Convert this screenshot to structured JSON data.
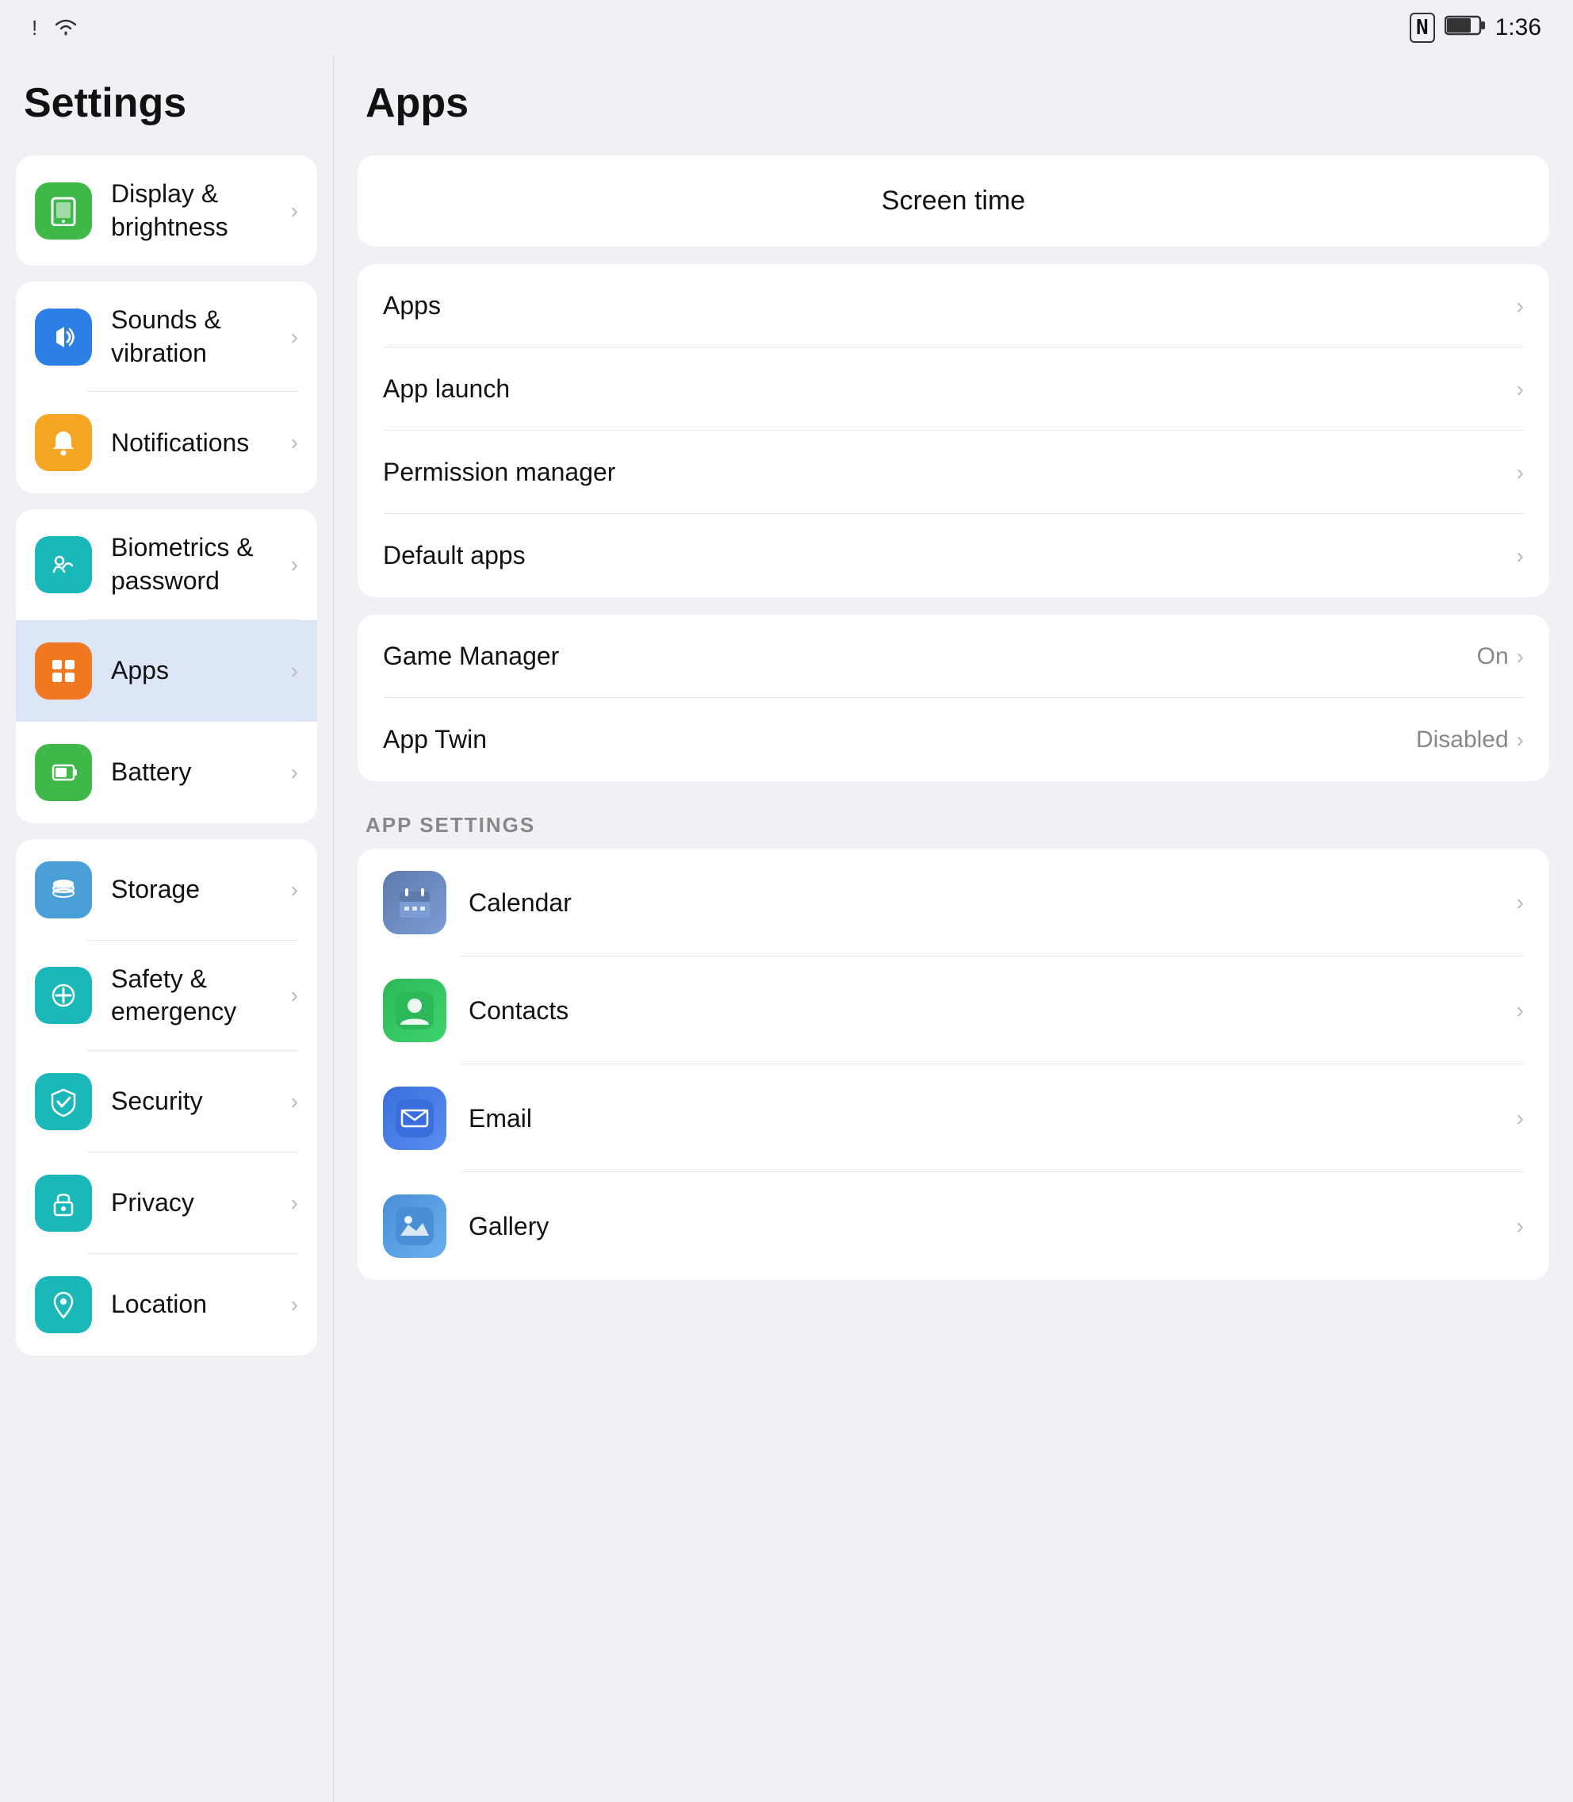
{
  "statusBar": {
    "time": "1:36",
    "battery": "🔋",
    "wifi": "📶",
    "nfc": "N",
    "alert": "!"
  },
  "leftPanel": {
    "title": "Settings",
    "cards": [
      {
        "id": "card1",
        "items": [
          {
            "id": "display",
            "iconClass": "icon-green",
            "iconSymbol": "📱",
            "label": "Display & brightness",
            "active": false
          }
        ]
      },
      {
        "id": "card2",
        "items": [
          {
            "id": "sounds",
            "iconClass": "icon-blue",
            "iconSymbol": "🔊",
            "label": "Sounds & vibration",
            "active": false
          },
          {
            "id": "notifications",
            "iconClass": "icon-orange",
            "iconSymbol": "🔔",
            "label": "Notifications",
            "active": false
          }
        ]
      },
      {
        "id": "card3",
        "items": [
          {
            "id": "biometrics",
            "iconClass": "icon-teal",
            "iconSymbol": "🔑",
            "label": "Biometrics & password",
            "active": false
          },
          {
            "id": "apps",
            "iconClass": "icon-orange2",
            "iconSymbol": "⊞",
            "label": "Apps",
            "active": true
          },
          {
            "id": "battery",
            "iconClass": "icon-green2",
            "iconSymbol": "🔋",
            "label": "Battery",
            "active": false
          }
        ]
      },
      {
        "id": "card4",
        "items": [
          {
            "id": "storage",
            "iconClass": "icon-blue2",
            "iconSymbol": "🗄",
            "label": "Storage",
            "active": false
          },
          {
            "id": "safety",
            "iconClass": "icon-teal2",
            "iconSymbol": "✱",
            "label": "Safety & emergency",
            "active": false
          },
          {
            "id": "security",
            "iconClass": "icon-teal3",
            "iconSymbol": "✔",
            "label": "Security",
            "active": false
          },
          {
            "id": "privacy",
            "iconClass": "icon-teal4",
            "iconSymbol": "🔒",
            "label": "Privacy",
            "active": false
          },
          {
            "id": "location",
            "iconClass": "icon-teal5",
            "iconSymbol": "📍",
            "label": "Location",
            "active": false
          }
        ]
      }
    ]
  },
  "rightPanel": {
    "title": "Apps",
    "screenTimeLabel": "Screen time",
    "mainItems": [
      {
        "id": "apps-item",
        "label": "Apps",
        "value": ""
      },
      {
        "id": "app-launch",
        "label": "App launch",
        "value": ""
      },
      {
        "id": "permission-manager",
        "label": "Permission manager",
        "value": ""
      },
      {
        "id": "default-apps",
        "label": "Default apps",
        "value": ""
      }
    ],
    "extraItems": [
      {
        "id": "game-manager",
        "label": "Game Manager",
        "value": "On"
      },
      {
        "id": "app-twin",
        "label": "App Twin",
        "value": "Disabled"
      }
    ],
    "appSettingsHeader": "APP SETTINGS",
    "appSettings": [
      {
        "id": "calendar",
        "label": "Calendar",
        "iconClass": "app-icon-calendar",
        "iconSymbol": "📅"
      },
      {
        "id": "contacts",
        "label": "Contacts",
        "iconClass": "app-icon-contacts",
        "iconSymbol": "👤"
      },
      {
        "id": "email",
        "label": "Email",
        "iconClass": "app-icon-email",
        "iconSymbol": "✉"
      },
      {
        "id": "gallery",
        "label": "Gallery",
        "iconClass": "app-icon-gallery",
        "iconSymbol": "🖼"
      }
    ]
  }
}
